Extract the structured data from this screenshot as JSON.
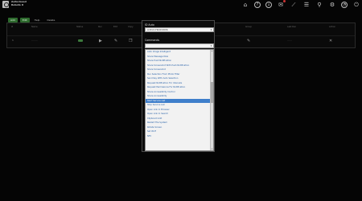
{
  "app": {
    "brand_line1": "Autoclosed",
    "brand_line2": "Robots X"
  },
  "top_icons": [
    "home-icon",
    "help-icon",
    "download-icon",
    "message-icon",
    "wand-icon",
    "notes-icon",
    "location-icon",
    "settings-icon",
    "time-icon",
    "power-icon"
  ],
  "tabs": [
    {
      "label": "Add",
      "style": "green"
    },
    {
      "label": "Edit",
      "style": "green"
    },
    {
      "label": "Help",
      "style": "plain"
    },
    {
      "label": "Delete",
      "style": "plain"
    }
  ],
  "table": {
    "headers": [
      "#",
      "Name",
      "Status",
      "Run",
      "Edit",
      "Copy",
      "Del",
      "Group",
      "Command",
      "Last Run",
      "Action"
    ],
    "row": {
      "index": "1",
      "name": "········",
      "status": "",
      "last_run": "······"
    }
  },
  "modal": {
    "id_label": "ID Auto",
    "id_value": "LIVE-ID-FROM-EXPR",
    "command_label": "Commands",
    "command_value": "",
    "list": [
      "Auto Image Intelligent",
      "Share Message Now",
      "Share Push Notification",
      "Share Screenshot With Push Notification",
      "Share Screenshot",
      "Run Selection From Photo Filter",
      "Send Key With Auto Selection",
      "Request Notification For Intervals",
      "Request Permissions For Notification",
      "Share Accessibility Control",
      "Share Accessibility",
      "Start Service List",
      "Stop Service List",
      "Open Link In Browser",
      "Open Link In Search",
      "Clipboard Add",
      "Restart File System",
      "Rotate Screen",
      "Set Wi-Fi",
      "NFC"
    ],
    "selected_index": 11
  },
  "colors": {
    "background": "#050505",
    "accent_green": "#2e6b2e",
    "selection_blue": "#3f7fcb",
    "link_blue": "#2a62a8"
  }
}
